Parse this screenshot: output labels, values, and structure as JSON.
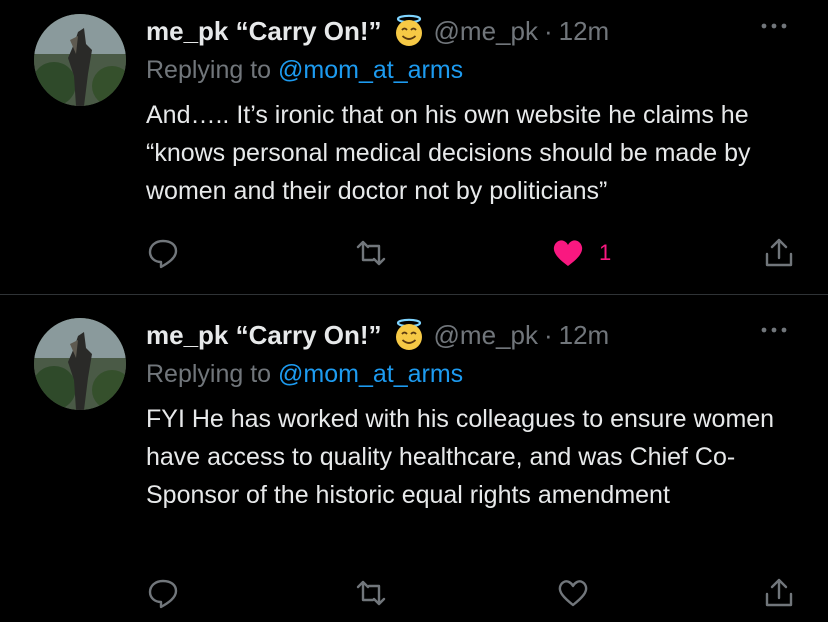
{
  "tweets": [
    {
      "author_name": "me_pk “Carry On!”",
      "emoji_icon": "smiling-face-with-halo-icon",
      "handle": "@me_pk",
      "separator": "·",
      "time": "12m",
      "replying_prefix": "Replying to",
      "replying_to": "@mom_at_arms",
      "text": "And….. It’s ironic that on his own website he claims he “knows personal medical decisions should be made by women and their doctor not by politicians”",
      "liked": true,
      "like_count": "1",
      "like_color": "#f91880"
    },
    {
      "author_name": "me_pk “Carry On!”",
      "emoji_icon": "smiling-face-with-halo-icon",
      "handle": "@me_pk",
      "separator": "·",
      "time": "12m",
      "replying_prefix": "Replying to",
      "replying_to": "@mom_at_arms",
      "text": "FYI He has worked with his colleagues to ensure women have access to quality healthcare, and was Chief Co-Sponsor of the historic equal rights amendment",
      "liked": false,
      "like_count": "",
      "like_color": "#71767b"
    }
  ],
  "colors": {
    "background": "#000000",
    "text": "#e7e9ea",
    "muted": "#71767b",
    "link": "#1d9bf0",
    "like": "#f91880",
    "divider": "#2f3336"
  }
}
